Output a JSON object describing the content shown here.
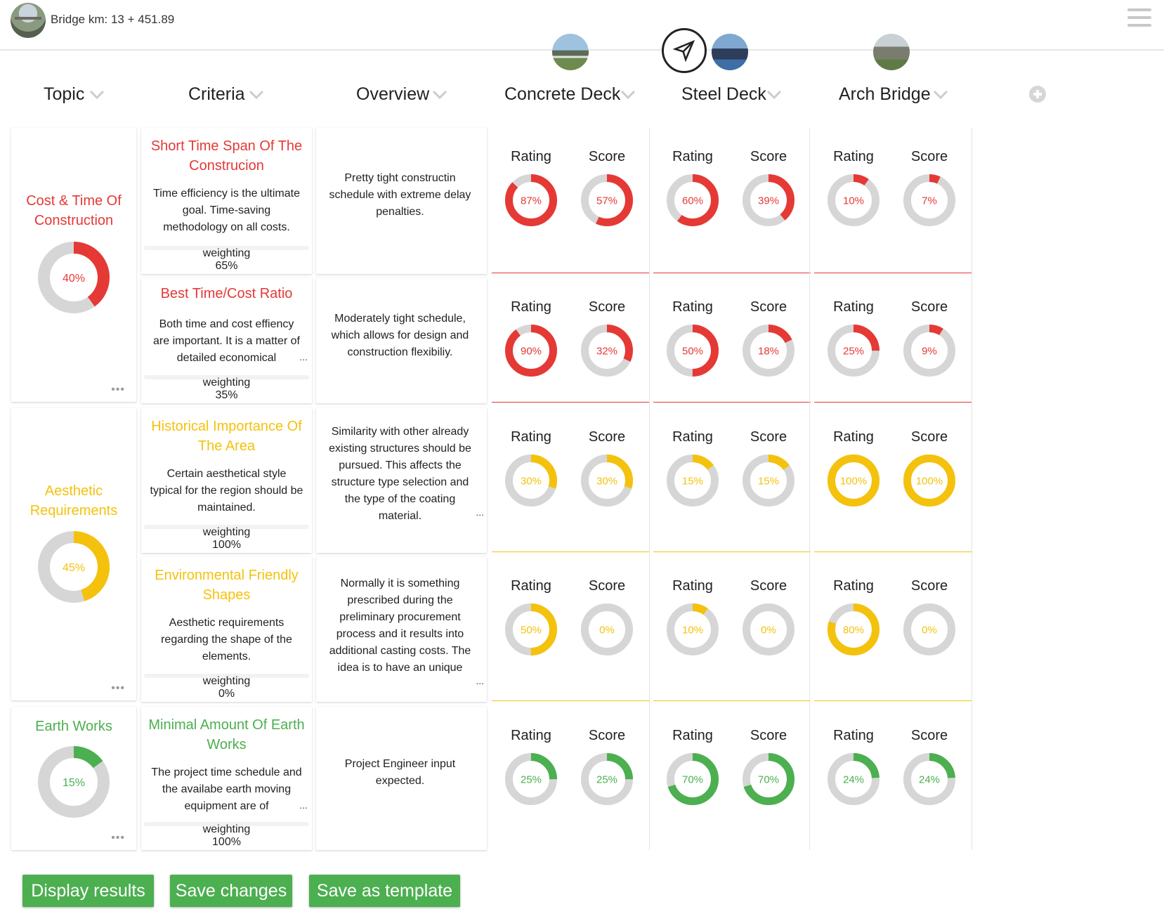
{
  "header": {
    "title": "Bridge km: 13 + 451.89"
  },
  "colors": {
    "red": "#e53935",
    "yellow": "#f4c20d",
    "green": "#4caf50",
    "track": "#d6d6d6"
  },
  "columns": {
    "topic": "Topic",
    "criteria": "Criteria",
    "overview": "Overview",
    "alternatives": [
      "Concrete Deck",
      "Steel Deck",
      "Arch Bridge"
    ]
  },
  "cell_labels": {
    "rating": "Rating",
    "score": "Score"
  },
  "topics": [
    {
      "title": "Cost & Time Of Construction",
      "title_lines": [
        "Cost & Time Of",
        "Construction"
      ],
      "percent_label": "40%",
      "value": 0.4,
      "color": "red",
      "more": "•••"
    },
    {
      "title": "Aesthetic Requirements",
      "title_lines": [
        "Aesthetic",
        "Requirements"
      ],
      "percent_label": "45%",
      "value": 0.45,
      "color": "yellow",
      "more": "•••"
    },
    {
      "title": "Earth Works",
      "title_lines": [
        "Earth Works"
      ],
      "percent_label": "15%",
      "value": 0.15,
      "color": "green",
      "more": "•••"
    }
  ],
  "criteria": [
    {
      "title_lines": [
        "Short Time Span Of The",
        "Construcion"
      ],
      "description": "Time efficiency is the ultimate goal. Time-saving methodology on all costs.",
      "weighting_label": "weighting",
      "weighting_value": "65%",
      "overview": "Pretty tight constructin schedule with extreme delay penalties.",
      "color": "red",
      "cells": [
        {
          "rating": "87%",
          "r": 0.87,
          "score": "57%",
          "s": 0.57
        },
        {
          "rating": "60%",
          "r": 0.6,
          "score": "39%",
          "s": 0.39
        },
        {
          "rating": "10%",
          "r": 0.1,
          "score": "7%",
          "s": 0.07
        }
      ]
    },
    {
      "title_lines": [
        "Best Time/Cost Ratio"
      ],
      "description": "Both time and cost effiency are important. It is a matter of detailed economical",
      "truncated": "...",
      "weighting_label": "weighting",
      "weighting_value": "35%",
      "overview": "Moderately tight schedule, which allows for design and construction flexibiliy.",
      "color": "red",
      "cells": [
        {
          "rating": "90%",
          "r": 0.9,
          "score": "32%",
          "s": 0.32
        },
        {
          "rating": "50%",
          "r": 0.5,
          "score": "18%",
          "s": 0.18
        },
        {
          "rating": "25%",
          "r": 0.25,
          "score": "9%",
          "s": 0.09
        }
      ]
    },
    {
      "title_lines": [
        "Historical Importance Of",
        "The Area"
      ],
      "description": "Certain aesthetical style typical for the region should be maintained.",
      "weighting_label": "weighting",
      "weighting_value": "100%",
      "overview": "Similarity with other already existing structures should be pursued. This affects the structure type selection and the type of the coating material.",
      "overview_truncated": "...",
      "color": "yellow",
      "cells": [
        {
          "rating": "30%",
          "r": 0.3,
          "score": "30%",
          "s": 0.3
        },
        {
          "rating": "15%",
          "r": 0.15,
          "score": "15%",
          "s": 0.15
        },
        {
          "rating": "100%",
          "r": 1.0,
          "score": "100%",
          "s": 1.0
        }
      ]
    },
    {
      "title_lines": [
        "Environmental Friendly",
        "Shapes"
      ],
      "description": "Aesthetic requirements regarding the shape of the elements.",
      "weighting_label": "weighting",
      "weighting_value": "0%",
      "overview": "Normally it is something prescribed during the preliminary procurement process and it results into additional casting costs. The idea is to have an unique",
      "overview_truncated": "...",
      "color": "yellow",
      "cells": [
        {
          "rating": "50%",
          "r": 0.5,
          "score": "0%",
          "s": 0.0
        },
        {
          "rating": "10%",
          "r": 0.1,
          "score": "0%",
          "s": 0.0
        },
        {
          "rating": "80%",
          "r": 0.8,
          "score": "0%",
          "s": 0.0
        }
      ]
    },
    {
      "title_lines": [
        "Minimal Amount Of Earth",
        "Works"
      ],
      "description": "The project time schedule and the availabe earth moving equipment are of",
      "truncated": "...",
      "weighting_label": "weighting",
      "weighting_value": "100%",
      "overview": "Project Engineer input expected.",
      "color": "green",
      "cells": [
        {
          "rating": "25%",
          "r": 0.25,
          "score": "25%",
          "s": 0.25
        },
        {
          "rating": "70%",
          "r": 0.7,
          "score": "70%",
          "s": 0.7
        },
        {
          "rating": "24%",
          "r": 0.24,
          "score": "24%",
          "s": 0.24
        }
      ]
    }
  ],
  "buttons": {
    "display": "Display results",
    "save": "Save changes",
    "template": "Save as template"
  }
}
